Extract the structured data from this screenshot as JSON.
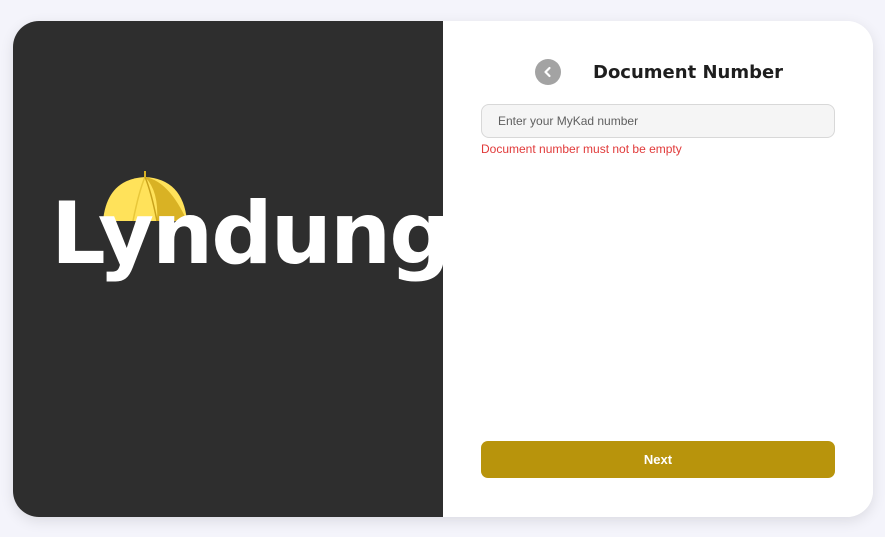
{
  "brand": {
    "name": "Lyndung",
    "logo_icon": "umbrella-icon",
    "colors": {
      "umbrella_light": "#ffe25a",
      "umbrella_dark": "#d9b224",
      "panel": "#2e2e2e"
    }
  },
  "header": {
    "title": "Document Number",
    "back_icon": "chevron-left-icon"
  },
  "form": {
    "document_input": {
      "placeholder": "Enter your MyKad number",
      "value": ""
    },
    "error_message": "Document number must not be empty",
    "next_label": "Next"
  },
  "colors": {
    "accent": "#b8940c",
    "error": "#e13a3a",
    "back_button": "#a3a3a3"
  }
}
